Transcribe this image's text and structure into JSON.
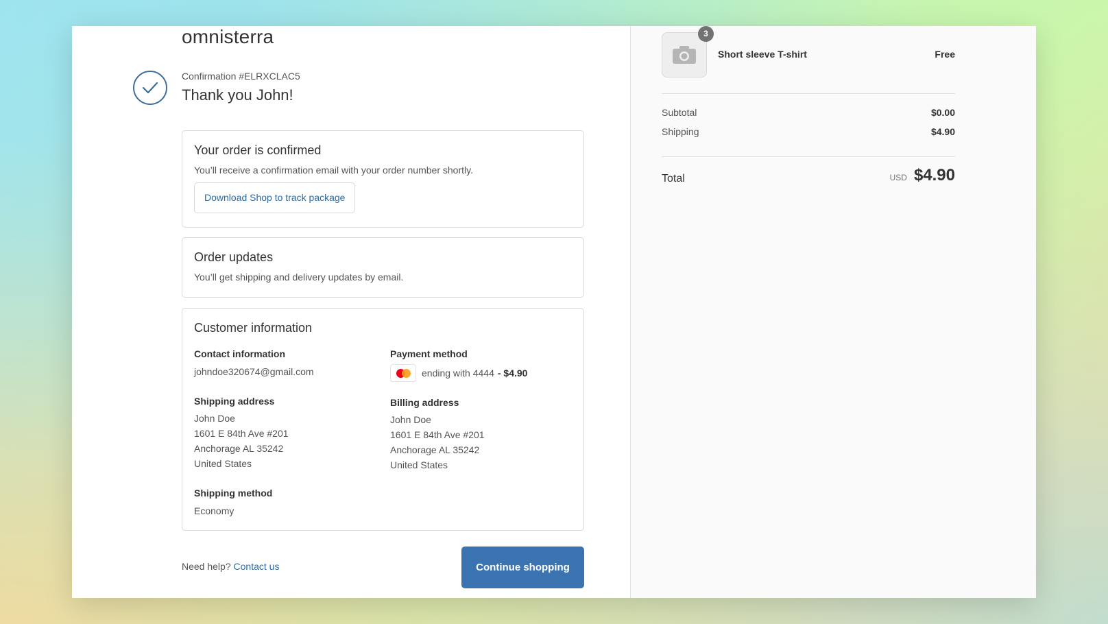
{
  "shop": {
    "name": "omnisterra"
  },
  "confirmation": {
    "number": "Confirmation #ELRXCLAC5",
    "thank_you": "Thank you John!"
  },
  "order_confirmed": {
    "title": "Your order is confirmed",
    "text": "You’ll receive a confirmation email with your order number shortly.",
    "track_button": "Download Shop to track package"
  },
  "order_updates": {
    "title": "Order updates",
    "text": "You’ll get shipping and delivery updates by email."
  },
  "customer_info": {
    "title": "Customer information",
    "contact": {
      "label": "Contact information",
      "email": "johndoe320674@gmail.com"
    },
    "payment": {
      "label": "Payment method",
      "text": "ending with 4444",
      "amount": "- $4.90"
    },
    "shipping_address": {
      "label": "Shipping address",
      "lines": [
        "John Doe",
        "1601 E 84th Ave #201",
        "Anchorage AL 35242",
        "United States"
      ]
    },
    "billing_address": {
      "label": "Billing address",
      "lines": [
        "John Doe",
        "1601 E 84th Ave #201",
        "Anchorage AL 35242",
        "United States"
      ]
    },
    "shipping_method": {
      "label": "Shipping method",
      "value": "Economy"
    }
  },
  "footer": {
    "help_text": "Need help?",
    "contact_link": "Contact us",
    "continue_button": "Continue shopping"
  },
  "summary": {
    "product": {
      "name": "Short sleeve T-shirt",
      "price": "Free",
      "quantity": "3",
      "thumbnail_icon": "camera-icon"
    },
    "subtotal_label": "Subtotal",
    "subtotal": "$0.00",
    "shipping_label": "Shipping",
    "shipping": "$4.90",
    "total_label": "Total",
    "currency": "USD",
    "total": "$4.90"
  },
  "colors": {
    "accent": "#3a73b0",
    "link": "#2f6aa0",
    "check": "#3c6e99"
  }
}
